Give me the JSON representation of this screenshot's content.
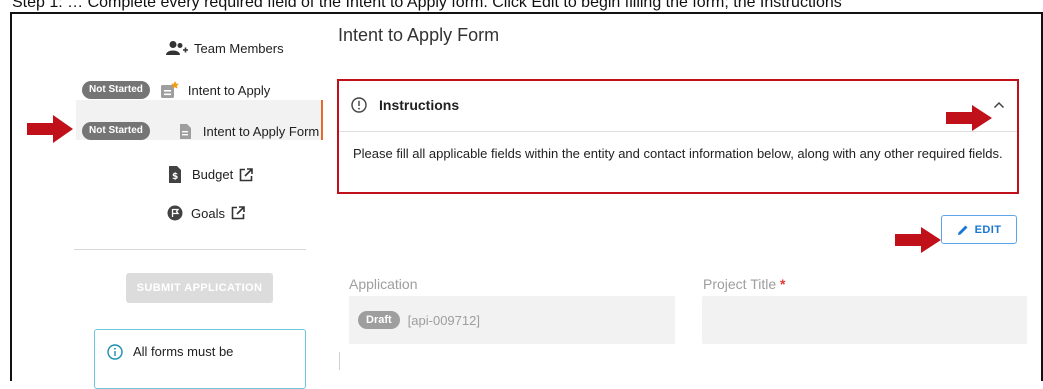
{
  "caption": "Step 1: … Complete every required field of the Intent to Apply form. Click Edit to begin filling the form; the Instructions",
  "sidebar": {
    "items": [
      {
        "label": "Team Members",
        "icon": "team-members-icon",
        "status": ""
      },
      {
        "label": "Intent to Apply",
        "icon": "intent-apply-icon",
        "status": "Not Started"
      },
      {
        "label": "Intent to Apply Form",
        "icon": "document-icon",
        "status": "Not Started"
      },
      {
        "label": "Budget",
        "icon": "budget-icon",
        "status": ""
      },
      {
        "label": "Goals",
        "icon": "goals-icon",
        "status": ""
      }
    ],
    "submit_label": "SUBMIT APPLICATION",
    "info_text": "All forms must be"
  },
  "main": {
    "title": "Intent to Apply Form",
    "instructions": {
      "heading": "Instructions",
      "text": "Please fill all applicable fields within the entity and contact information below, along with any other required fields."
    },
    "edit_label": "EDIT",
    "fields": {
      "application_label": "Application",
      "application_status": "Draft",
      "application_id": "[api-009712]",
      "project_title_label": "Project Title",
      "required_marker": "*"
    }
  },
  "colors": {
    "accent_blue": "#1976d2",
    "annotation_red": "#c0101a",
    "active_marker": "#e46b2c"
  }
}
